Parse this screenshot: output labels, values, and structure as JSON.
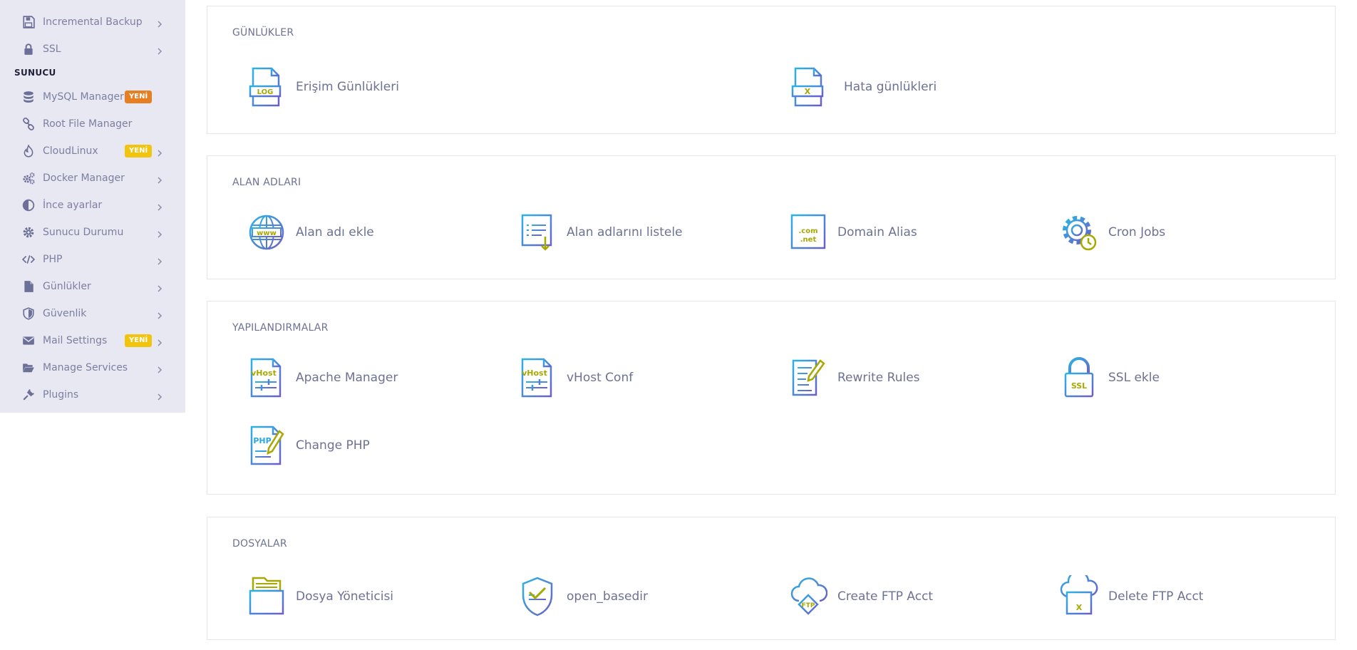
{
  "sidebar": {
    "top_items": [
      {
        "label": "Incremental Backup",
        "icon": "save-icon",
        "chevron": true
      },
      {
        "label": "SSL",
        "icon": "lock-icon",
        "chevron": true
      }
    ],
    "section_label": "SUNUCU",
    "items": [
      {
        "label": "MySQL Manager",
        "icon": "database-icon",
        "badge": "YENİ",
        "badge_color": "#e67e22",
        "chevron": false
      },
      {
        "label": "Root File Manager",
        "icon": "link-icon",
        "chevron": false
      },
      {
        "label": "CloudLinux",
        "icon": "fire-icon",
        "badge": "YENİ",
        "badge_color": "#f1c40f",
        "chevron": true
      },
      {
        "label": "Docker Manager",
        "icon": "cogs-icon",
        "chevron": true
      },
      {
        "label": "İnce ayarlar",
        "icon": "contrast-icon",
        "chevron": true
      },
      {
        "label": "Sunucu Durumu",
        "icon": "gear-icon",
        "chevron": true
      },
      {
        "label": "PHP",
        "icon": "code-icon",
        "chevron": true
      },
      {
        "label": "Günlükler",
        "icon": "file-icon",
        "chevron": true
      },
      {
        "label": "Güvenlik",
        "icon": "shield-icon",
        "chevron": true
      },
      {
        "label": "Mail Settings",
        "icon": "envelope-icon",
        "badge": "YENİ",
        "badge_color": "#f1c40f",
        "chevron": true
      },
      {
        "label": "Manage Services",
        "icon": "folder-open-icon",
        "chevron": true
      },
      {
        "label": "Plugins",
        "icon": "plug-icon",
        "chevron": true
      }
    ]
  },
  "sections": [
    {
      "title": "GÜNLÜKLER",
      "tiles": [
        {
          "label": "Erişim Günlükleri",
          "icon": "log-file-icon"
        },
        {
          "label": "Hata günlükleri",
          "icon": "error-file-icon"
        }
      ]
    },
    {
      "title": "ALAN ADLARI",
      "tiles": [
        {
          "label": "Alan adı ekle",
          "icon": "globe-www-icon"
        },
        {
          "label": "Alan adlarını listele",
          "icon": "list-document-icon"
        },
        {
          "label": "Domain Alias",
          "icon": "domain-browser-icon"
        },
        {
          "label": "Cron Jobs",
          "icon": "gear-clock-icon"
        }
      ]
    },
    {
      "title": "YAPILANDIRMALAR",
      "tiles": [
        {
          "label": "Apache Manager",
          "icon": "vhost-file-icon"
        },
        {
          "label": "vHost Conf",
          "icon": "vhost-file-icon"
        },
        {
          "label": "Rewrite Rules",
          "icon": "edit-document-icon"
        },
        {
          "label": "SSL ekle",
          "icon": "ssl-lock-icon"
        },
        {
          "label": "Change PHP",
          "icon": "php-file-icon"
        }
      ]
    },
    {
      "title": "DOSYALAR",
      "tiles": [
        {
          "label": "Dosya Yöneticisi",
          "icon": "file-cabinet-icon"
        },
        {
          "label": "open_basedir",
          "icon": "shield-check-icon"
        },
        {
          "label": "Create FTP Acct",
          "icon": "cloud-ftp-icon"
        },
        {
          "label": "Delete FTP Acct",
          "icon": "cloud-delete-icon"
        }
      ]
    }
  ],
  "icon_text": {
    "log": "LOG",
    "x": "X",
    "www": "www",
    "com": ".com",
    "net": ".net",
    "vhost": "vHost",
    "ssl": "SSL",
    "php": "PHP",
    "ftp": "FTP"
  },
  "colors": {
    "accent_blue": "#2ba8e0",
    "accent_purple": "#6a5fc7",
    "accent_olive": "#a8a800",
    "badge_orange": "#e67e22",
    "badge_yellow": "#f1c40f"
  }
}
